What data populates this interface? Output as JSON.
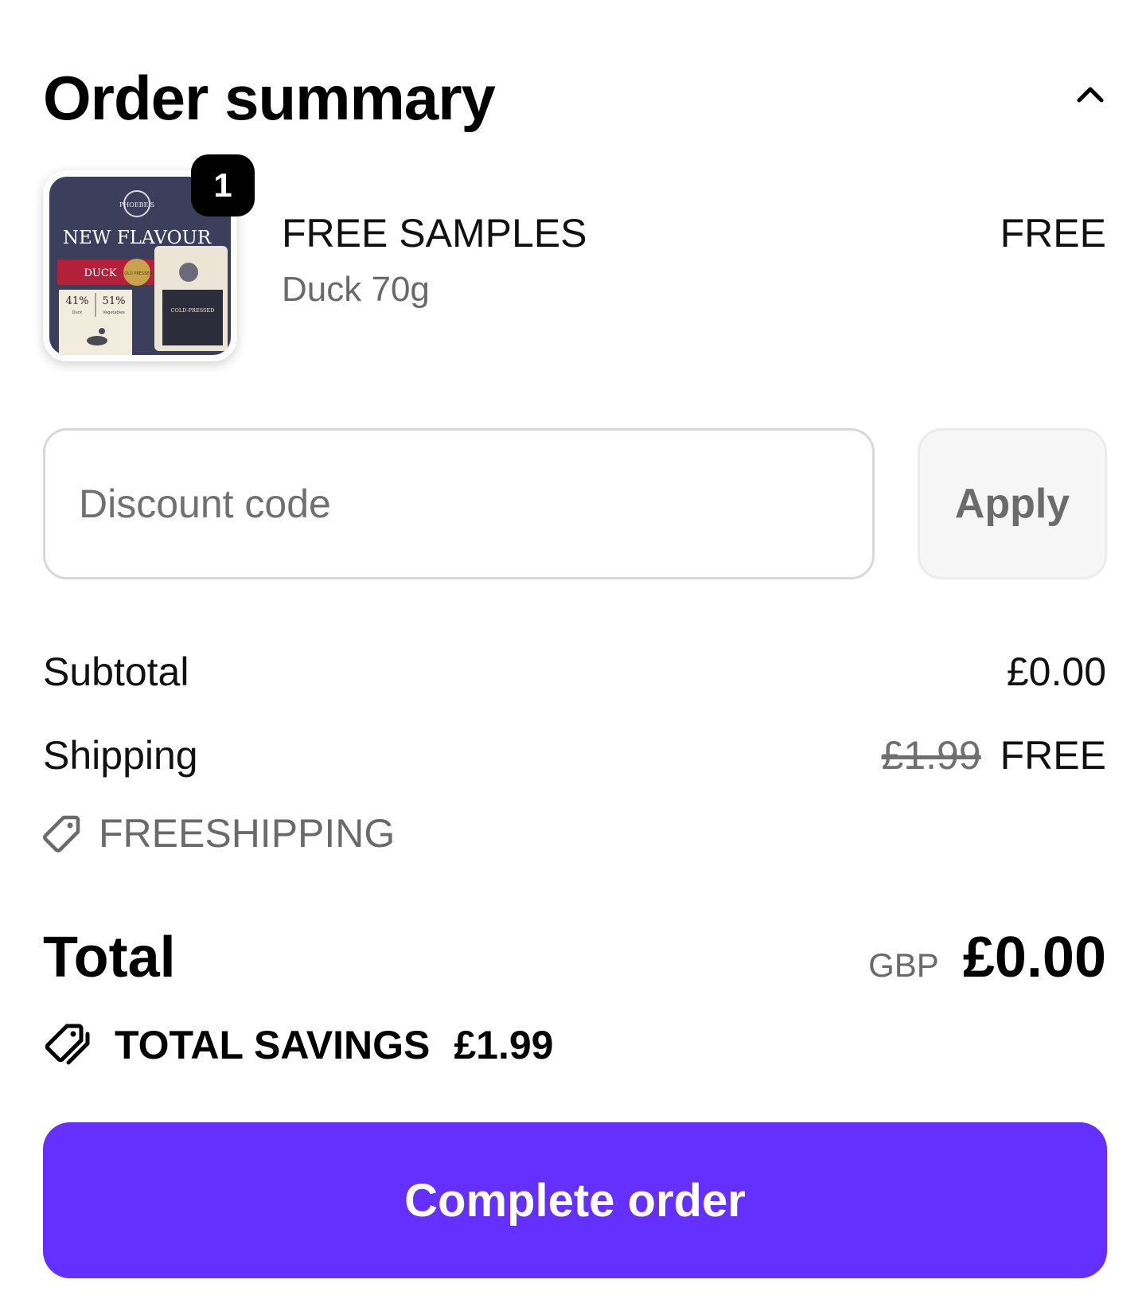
{
  "header": {
    "title": "Order summary",
    "toggle_icon": "chevron-up-icon"
  },
  "product": {
    "quantity": "1",
    "name": "FREE SAMPLES",
    "variant": "Duck 70g",
    "price": "FREE",
    "image": {
      "brand": "PHOEBE'S",
      "headline": "NEW FLAVOUR",
      "banner": "DUCK",
      "stat1_value": "41%",
      "stat1_label": "Duck",
      "stat2_value": "51%",
      "stat2_label": "Vegetables",
      "seal": "COLD PRESSED",
      "bag_label": "COLD-PRESSED"
    }
  },
  "discount": {
    "placeholder": "Discount code",
    "apply_label": "Apply"
  },
  "summary": {
    "subtotal_label": "Subtotal",
    "subtotal_value": "£0.00",
    "shipping_label": "Shipping",
    "shipping_original": "£1.99",
    "shipping_value": "FREE",
    "discount_code": "FREESHIPPING"
  },
  "total": {
    "label": "Total",
    "currency": "GBP",
    "amount": "£0.00"
  },
  "savings": {
    "label": "TOTAL SAVINGS",
    "amount": "£1.99"
  },
  "cta": {
    "label": "Complete order"
  },
  "colors": {
    "primary": "#6430ff",
    "muted_text": "#6a6a6a",
    "border": "#d8d8d8"
  }
}
